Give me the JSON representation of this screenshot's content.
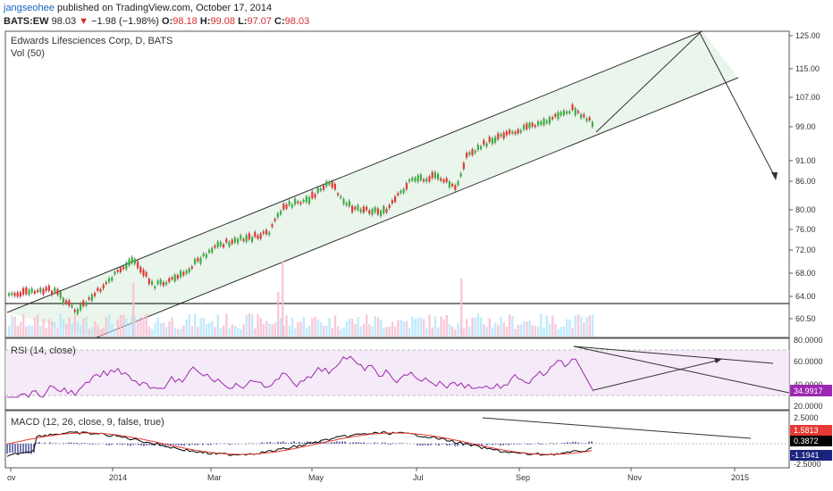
{
  "header": {
    "user": "jangseohee",
    "published": "published on TradingView.com, October 17, 2014",
    "symbol": "BATS:EW",
    "last": "98.03",
    "arrow": "▼",
    "change": "−1.98 (−1.98%)",
    "o_label": "O:",
    "o_val": "98.18",
    "h_label": "H:",
    "h_val": "99.08",
    "l_label": "L:",
    "l_val": "97.07",
    "c_label": "C:",
    "c_val": "98.03"
  },
  "panes": {
    "price": {
      "title": "Edwards Lifesciences Corp, D, BATS",
      "sub": "Vol (50)"
    },
    "rsi": {
      "title": "RSI (14, close)",
      "value": "34.9917"
    },
    "macd": {
      "title": "MACD (12, 26, close, 9, false, true)",
      "v1": "1.5813",
      "v2": "0.3872",
      "v3": "-1.1941"
    }
  },
  "axis": {
    "price_ticks": [
      "125.00",
      "115.00",
      "107.00",
      "99.00",
      "91.00",
      "86.00",
      "80.00",
      "76.00",
      "72.00",
      "68.00",
      "64.00",
      "60.50"
    ],
    "rsi_ticks": [
      "80.0000",
      "60.0000",
      "40.0000",
      "20.0000"
    ],
    "macd_ticks": [
      "2.5000",
      "-2.5000"
    ],
    "x_labels": [
      "ov",
      "2014",
      "Mar",
      "May",
      "Jul",
      "Sep",
      "Nov",
      "2015"
    ]
  },
  "colors": {
    "up": "#3cb043",
    "down": "#e53935",
    "rsi": "#9c27b0",
    "macd": "#000000",
    "signal": "#e53935",
    "hist": "#1a237e",
    "channel": "#e8f5e9"
  }
}
